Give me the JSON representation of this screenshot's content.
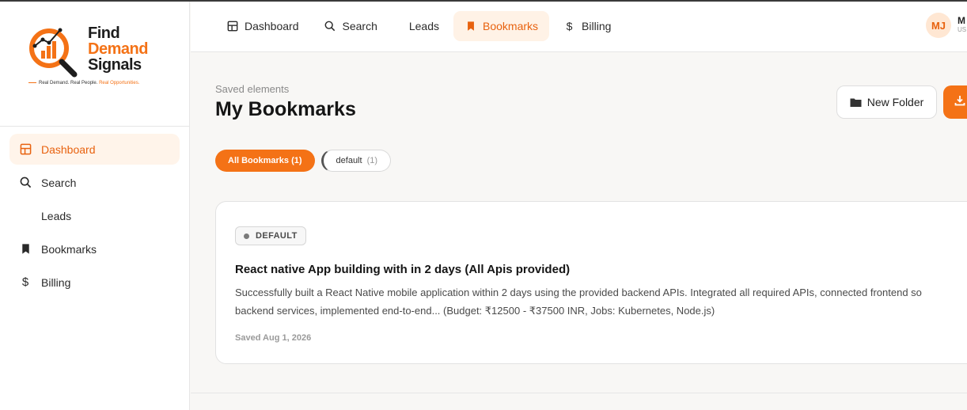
{
  "brand": {
    "line1": "Find",
    "line2": "Demand",
    "line3": "Signals",
    "tagline_a": "Real Demand. Real People.",
    "tagline_b": "Real Opportunities.",
    "accent": "#f47216"
  },
  "sidebar": {
    "items": [
      {
        "label": "Dashboard",
        "icon": "grid-icon",
        "active": true
      },
      {
        "label": "Search",
        "icon": "search-icon"
      },
      {
        "label": "Leads",
        "icon": ""
      },
      {
        "label": "Bookmarks",
        "icon": "bookmark-icon"
      },
      {
        "label": "Billing",
        "icon": "dollar-icon"
      }
    ]
  },
  "topnav": {
    "items": [
      {
        "label": "Dashboard",
        "icon": "grid-icon"
      },
      {
        "label": "Search",
        "icon": "search-icon"
      },
      {
        "label": "Leads",
        "icon": ""
      },
      {
        "label": "Bookmarks",
        "icon": "bookmark-icon",
        "active": true
      },
      {
        "label": "Billing",
        "icon": "dollar-icon"
      }
    ]
  },
  "user": {
    "initials": "MJ",
    "name": "M",
    "role": "US"
  },
  "page": {
    "kicker": "Saved elements",
    "title": "My Bookmarks",
    "new_folder_label": "New Folder"
  },
  "filters": [
    {
      "label": "All Bookmarks (1)",
      "active": true
    },
    {
      "label": "default",
      "count": "(1)"
    }
  ],
  "bookmark": {
    "badge": "DEFAULT",
    "title": "React native App building with in 2 days (All Apis provided)",
    "desc_line1": "Successfully built a React Native mobile application within 2 days using the provided backend APIs. Integrated all required APIs, connected frontend so",
    "desc_line2": "backend services, implemented end-to-end... (Budget: ₹12500 - ₹37500 INR, Jobs: Kubernetes, Node.js)",
    "saved": "Saved Aug 1, 2026"
  }
}
